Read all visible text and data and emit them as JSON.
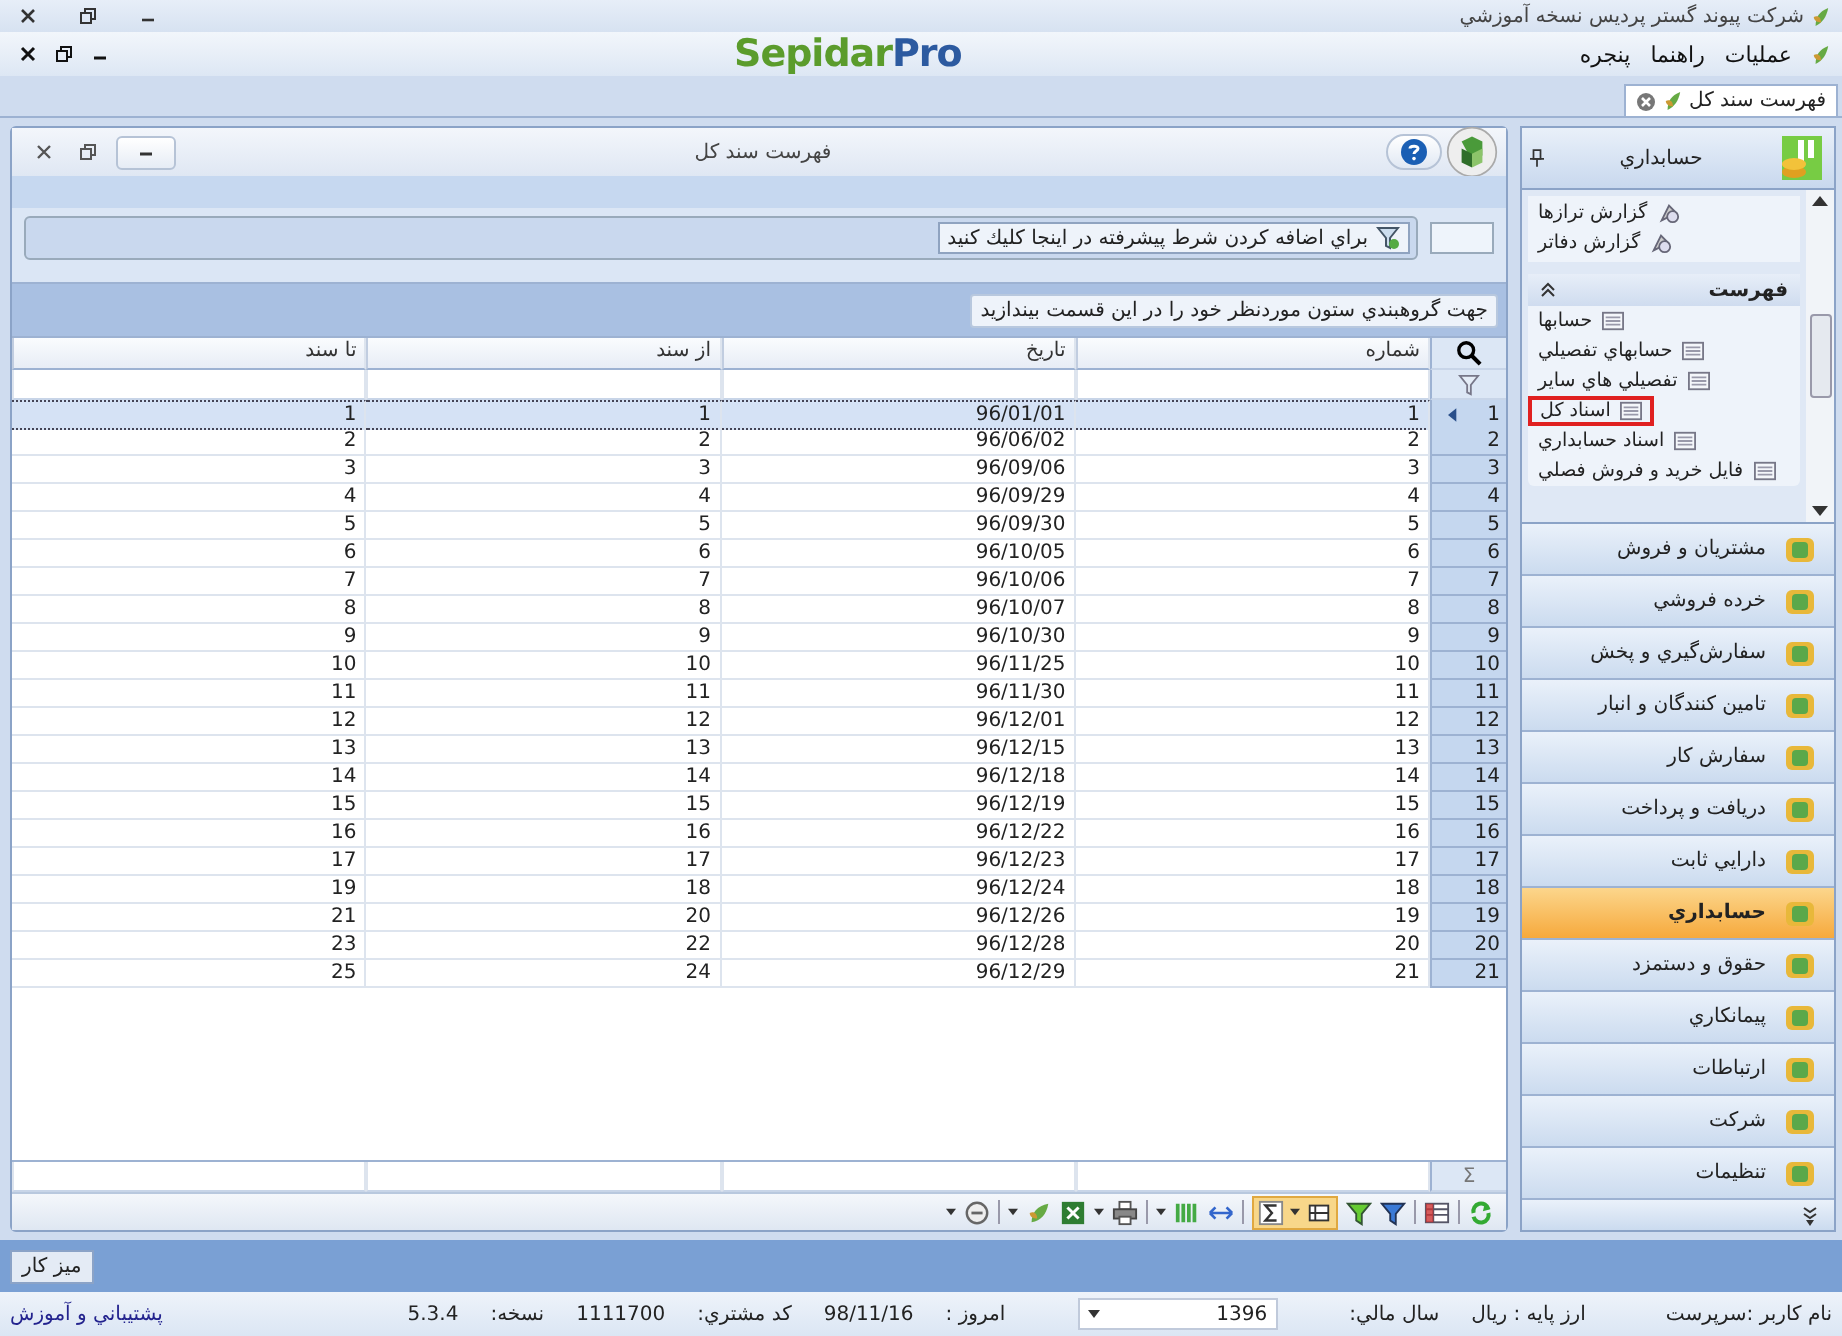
{
  "app": {
    "title": "شركت پيوند گستر پرديس نسخه آموزشي",
    "logo_part_1": "Sepidar",
    "logo_part_2": "Pro"
  },
  "menu": [
    "عمليات",
    "راهنما",
    "پنجره"
  ],
  "document_tabs": [
    {
      "label": "فهرست سند كل",
      "selected": true
    }
  ],
  "window": {
    "title": "فهرست سند كل",
    "filter_button": "براي اضافه كردن شرط پيشرفته در اينجا كليك كنيد",
    "group_panel_hint": "جهت گروهبندي ستون موردنظر خود را در اين قسمت بيندازيد"
  },
  "table": {
    "columns": [
      "شماره",
      "تاريخ",
      "از سند",
      "تا سند"
    ],
    "footer_symbol": "Σ",
    "rows": [
      {
        "index": "1",
        "cells": [
          "1",
          "96/01/01",
          "1",
          "1"
        ],
        "selected": true
      },
      {
        "index": "2",
        "cells": [
          "2",
          "96/06/02",
          "2",
          "2"
        ],
        "selected": false
      },
      {
        "index": "3",
        "cells": [
          "3",
          "96/09/06",
          "3",
          "3"
        ],
        "selected": false
      },
      {
        "index": "4",
        "cells": [
          "4",
          "96/09/29",
          "4",
          "4"
        ],
        "selected": false
      },
      {
        "index": "5",
        "cells": [
          "5",
          "96/09/30",
          "5",
          "5"
        ],
        "selected": false
      },
      {
        "index": "6",
        "cells": [
          "6",
          "96/10/05",
          "6",
          "6"
        ],
        "selected": false
      },
      {
        "index": "7",
        "cells": [
          "7",
          "96/10/06",
          "7",
          "7"
        ],
        "selected": false
      },
      {
        "index": "8",
        "cells": [
          "8",
          "96/10/07",
          "8",
          "8"
        ],
        "selected": false
      },
      {
        "index": "9",
        "cells": [
          "9",
          "96/10/30",
          "9",
          "9"
        ],
        "selected": false
      },
      {
        "index": "10",
        "cells": [
          "10",
          "96/11/25",
          "10",
          "10"
        ],
        "selected": false
      },
      {
        "index": "11",
        "cells": [
          "11",
          "96/11/30",
          "11",
          "11"
        ],
        "selected": false
      },
      {
        "index": "12",
        "cells": [
          "12",
          "96/12/01",
          "12",
          "12"
        ],
        "selected": false
      },
      {
        "index": "13",
        "cells": [
          "13",
          "96/12/15",
          "13",
          "13"
        ],
        "selected": false
      },
      {
        "index": "14",
        "cells": [
          "14",
          "96/12/18",
          "14",
          "14"
        ],
        "selected": false
      },
      {
        "index": "15",
        "cells": [
          "15",
          "96/12/19",
          "15",
          "15"
        ],
        "selected": false
      },
      {
        "index": "16",
        "cells": [
          "16",
          "96/12/22",
          "16",
          "16"
        ],
        "selected": false
      },
      {
        "index": "17",
        "cells": [
          "17",
          "96/12/23",
          "17",
          "17"
        ],
        "selected": false
      },
      {
        "index": "18",
        "cells": [
          "18",
          "96/12/24",
          "18",
          "19"
        ],
        "selected": false
      },
      {
        "index": "19",
        "cells": [
          "19",
          "96/12/26",
          "20",
          "21"
        ],
        "selected": false
      },
      {
        "index": "20",
        "cells": [
          "20",
          "96/12/28",
          "22",
          "23"
        ],
        "selected": false
      },
      {
        "index": "21",
        "cells": [
          "21",
          "96/12/29",
          "24",
          "25"
        ],
        "selected": false
      }
    ]
  },
  "sidebar": {
    "header": "حسابداري",
    "top_items": [
      {
        "label": "گزارش ترازها",
        "selected": false
      },
      {
        "label": "گزارش دفاتر",
        "selected": false
      }
    ],
    "section": {
      "title": "فهرست",
      "expanded": true,
      "items": [
        {
          "label": "حسابها",
          "selected": false
        },
        {
          "label": "حسابهاي تفصيلي",
          "selected": false
        },
        {
          "label": "تفصيلي هاي ساير",
          "selected": false
        },
        {
          "label": "اسناد كل",
          "selected": true
        },
        {
          "label": "اسناد حسابداري",
          "selected": false
        },
        {
          "label": "فايل خريد و فروش فصلي",
          "selected": false
        }
      ]
    }
  },
  "modules": [
    {
      "label": "مشتريان و فروش",
      "selected": false
    },
    {
      "label": "خرده فروشي",
      "selected": false
    },
    {
      "label": "سفارش‌گيري و پخش",
      "selected": false
    },
    {
      "label": "تامين كنندگان و انبار",
      "selected": false
    },
    {
      "label": "سفارش كار",
      "selected": false
    },
    {
      "label": "دريافت و پرداخت",
      "selected": false
    },
    {
      "label": "دارايي ثابت",
      "selected": false
    },
    {
      "label": "حسابداري",
      "selected": true
    },
    {
      "label": "حقوق و دستمزد",
      "selected": false
    },
    {
      "label": "پيمانكاري",
      "selected": false
    },
    {
      "label": "ارتباطات",
      "selected": false
    },
    {
      "label": "شركت",
      "selected": false
    },
    {
      "label": "تنظيمات",
      "selected": false
    }
  ],
  "taskbar": [
    "ميز كار"
  ],
  "status_bar": {
    "user": "نام كاربر :سرپرست",
    "currency": "ارز پايه :  ريال",
    "fiscal_year_label": "سال مالي:",
    "fiscal_year": "1396",
    "today_label": "امروز :",
    "today": "98/11/16",
    "customer_code_label": "كد مشتري:",
    "customer_code": "1111700",
    "version_label": "نسخه:",
    "version": "5.3.4",
    "support_link": "پشتيباني و آموزش"
  }
}
